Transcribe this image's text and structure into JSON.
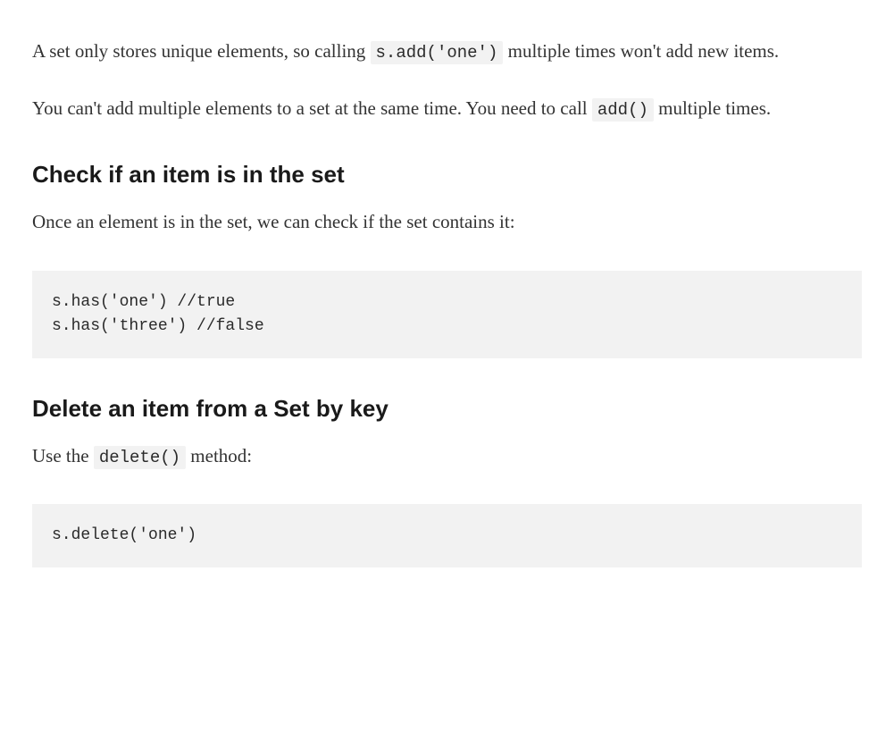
{
  "para1": {
    "pre": "A set only stores unique elements, so calling ",
    "code": "s.add('one')",
    "post": " multiple times won't add new items."
  },
  "para2": {
    "pre": "You can't add multiple elements to a set at the same time. You need to call ",
    "code": "add()",
    "post": " multiple times."
  },
  "heading1": "Check if an item is in the set",
  "para3": "Once an element is in the set, we can check if the set contains it:",
  "codeblock1": "s.has('one') //true\ns.has('three') //false",
  "heading2": "Delete an item from a Set by key",
  "para4": {
    "pre": "Use the ",
    "code": "delete()",
    "post": " method:"
  },
  "codeblock2": "s.delete('one')"
}
